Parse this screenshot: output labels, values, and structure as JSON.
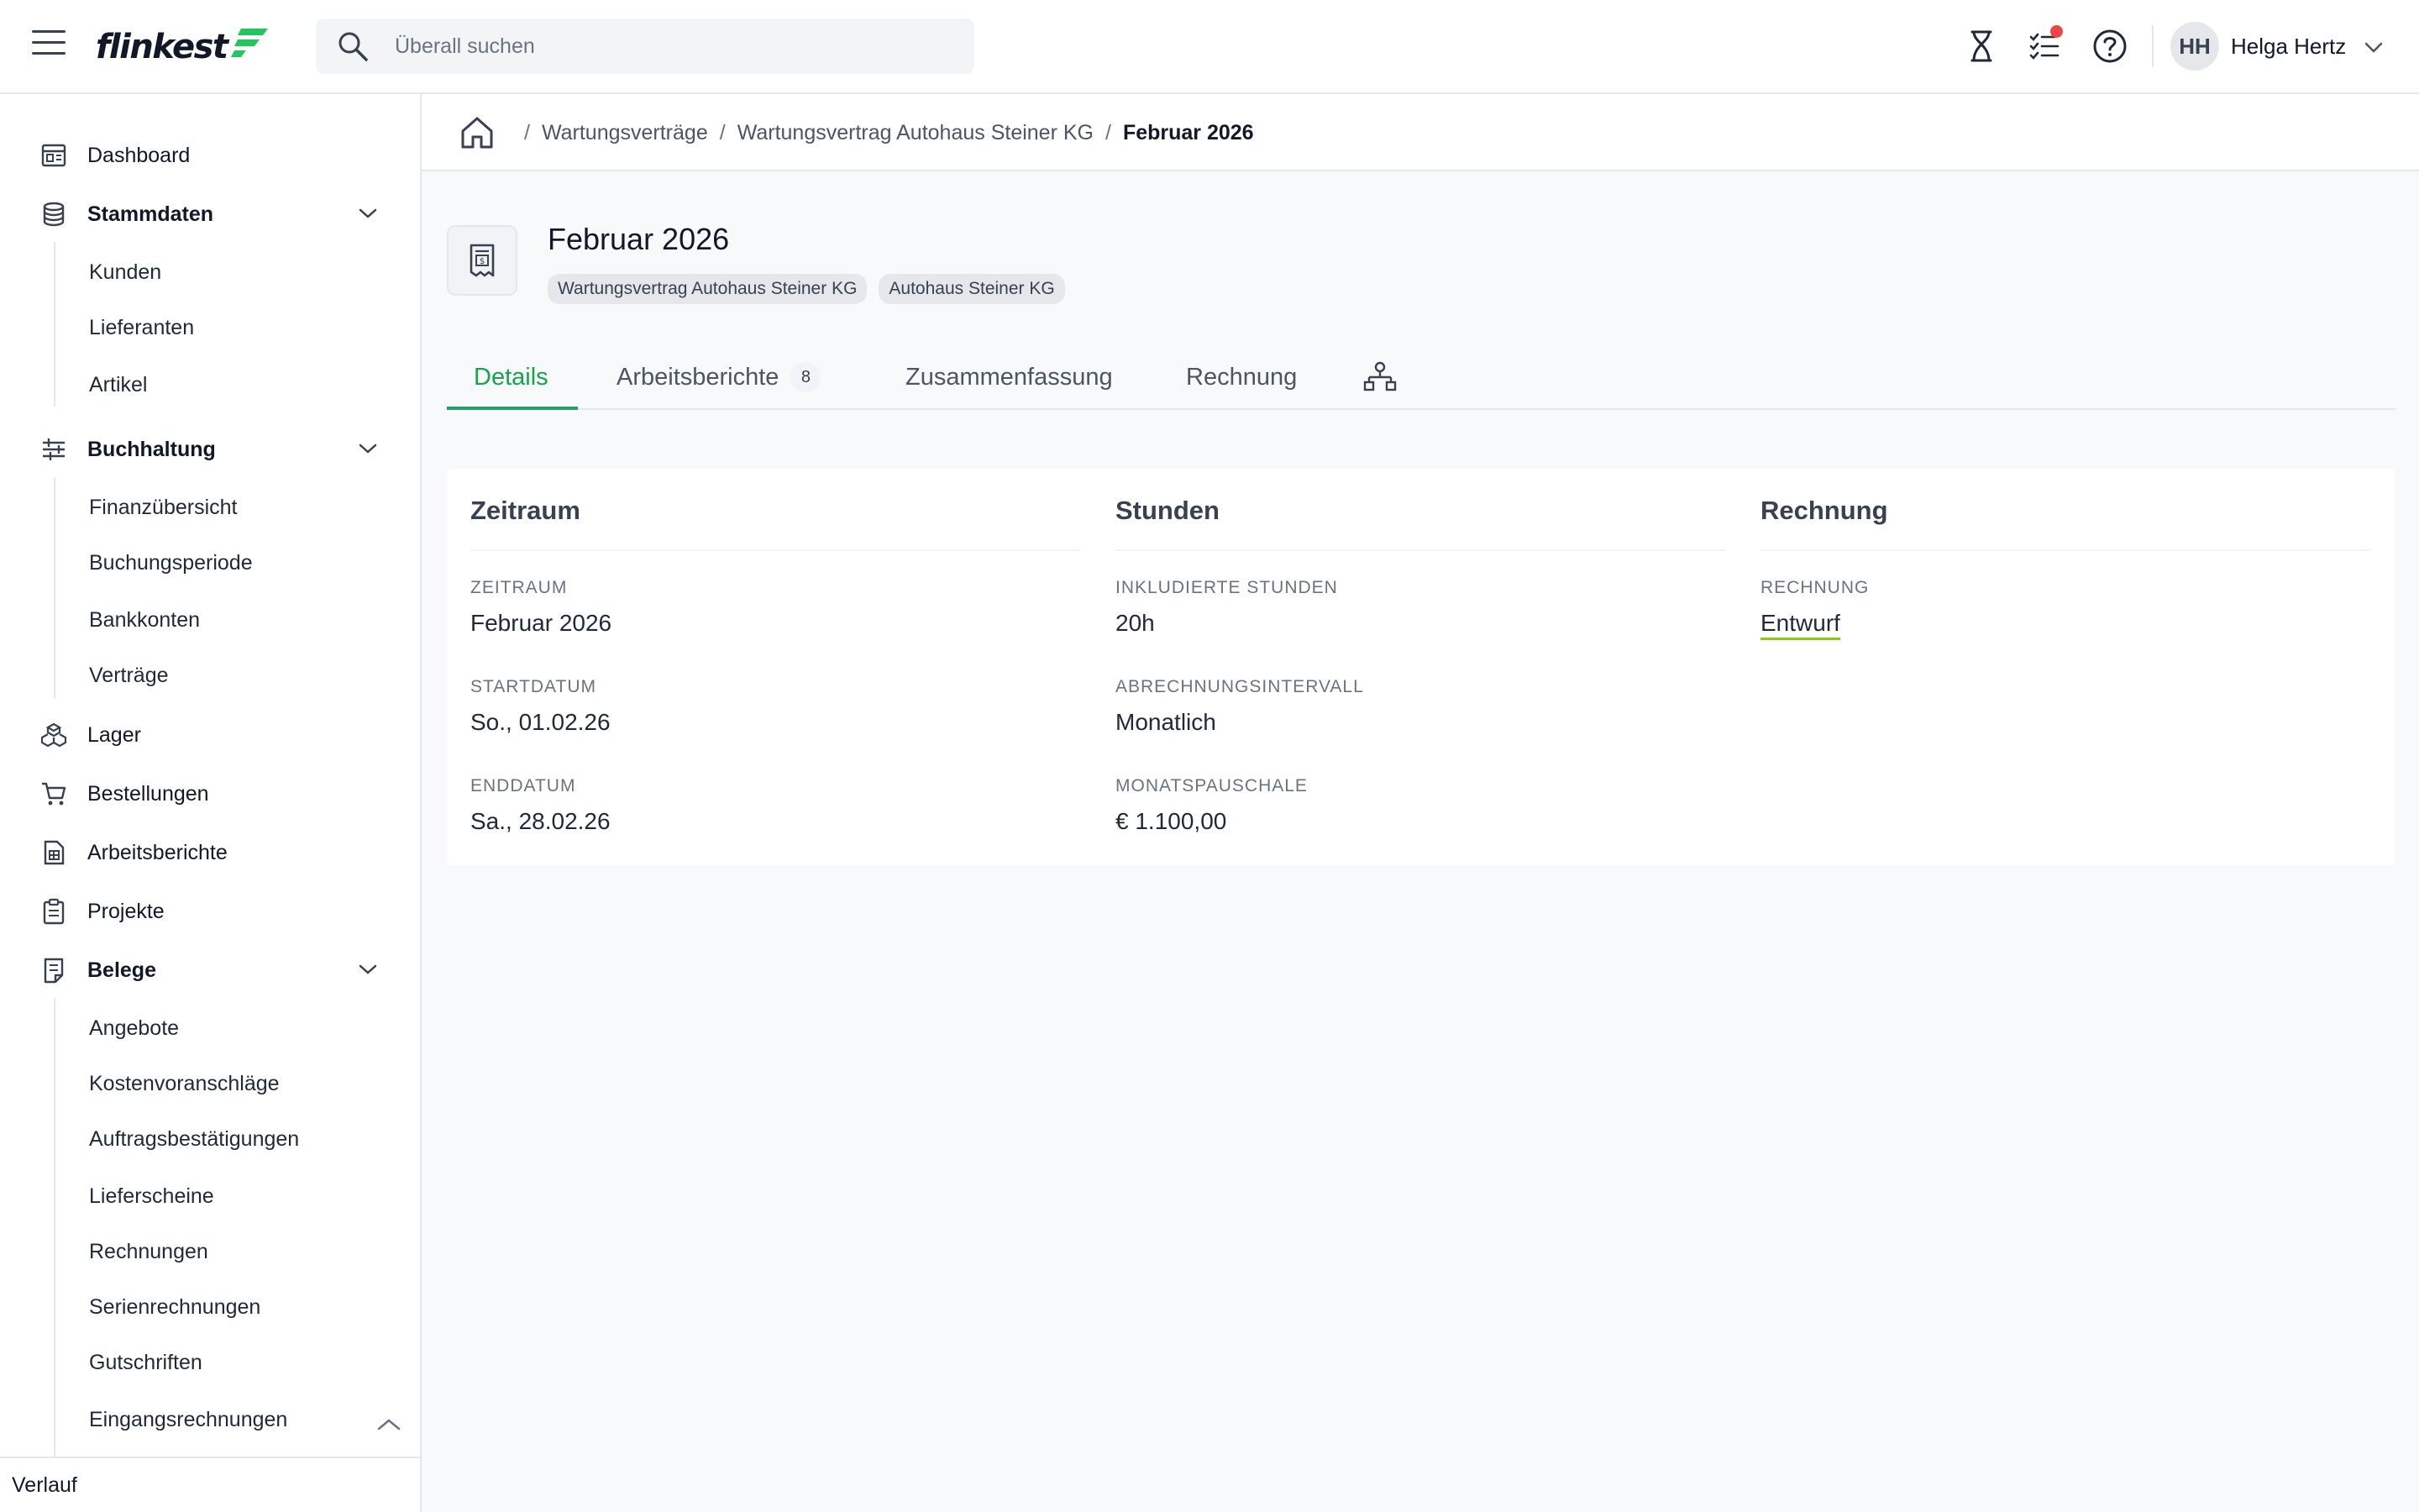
{
  "topbar": {
    "logo_text": "flinkest",
    "brand_color": "#22c55e",
    "search_placeholder": "Überall suchen",
    "icons": [
      "hamburger-icon",
      "search-icon",
      "hourglass-icon",
      "task-list-icon",
      "help-icon",
      "chevron-down-icon"
    ],
    "user": {
      "initials": "HH",
      "name": "Helga Hertz"
    }
  },
  "sidebar": {
    "items": [
      {
        "label": "Dashboard",
        "icon": "dashboard-icon"
      },
      {
        "label": "Stammdaten",
        "icon": "database-icon",
        "expanded": true,
        "children": [
          "Kunden",
          "Lieferanten",
          "Artikel"
        ]
      },
      {
        "label": "Buchhaltung",
        "icon": "sliders-icon",
        "expanded": true,
        "children": [
          "Finanzübersicht",
          "Buchungsperiode",
          "Bankkonten",
          "Verträge"
        ]
      },
      {
        "label": "Lager",
        "icon": "boxes-icon"
      },
      {
        "label": "Bestellungen",
        "icon": "cart-icon"
      },
      {
        "label": "Arbeitsberichte",
        "icon": "report-icon"
      },
      {
        "label": "Projekte",
        "icon": "clipboard-icon"
      },
      {
        "label": "Belege",
        "icon": "receipt-icon",
        "expanded": true,
        "children": [
          "Angebote",
          "Kostenvoranschläge",
          "Auftragsbestätigungen",
          "Lieferscheine",
          "Rechnungen",
          "Serienrechnungen",
          "Gutschriften",
          "Eingangsrechnungen"
        ]
      }
    ],
    "footer": "Verlauf"
  },
  "breadcrumb": {
    "items": [
      "Wartungsverträge",
      "Wartungsvertrag Autohaus Steiner KG"
    ],
    "current": "Februar 2026"
  },
  "header": {
    "title": "Februar 2026",
    "tags": [
      "Wartungsvertrag Autohaus Steiner KG",
      "Autohaus Steiner KG"
    ]
  },
  "tabs": [
    {
      "label": "Details",
      "active": true
    },
    {
      "label": "Arbeitsberichte",
      "count": "8"
    },
    {
      "label": "Zusammenfassung"
    },
    {
      "label": "Rechnung"
    },
    {
      "label": "",
      "icon": "hierarchy-icon"
    }
  ],
  "details": {
    "zeitraum": {
      "title": "Zeitraum",
      "fields": [
        {
          "label": "ZEITRAUM",
          "value": "Februar 2026"
        },
        {
          "label": "STARTDATUM",
          "value": "So., 01.02.26"
        },
        {
          "label": "ENDDATUM",
          "value": "Sa., 28.02.26"
        }
      ]
    },
    "stunden": {
      "title": "Stunden",
      "fields": [
        {
          "label": "INKLUDIERTE STUNDEN",
          "value": "20h"
        },
        {
          "label": "ABRECHNUNGSINTERVALL",
          "value": "Monatlich"
        },
        {
          "label": "MONATSPAUSCHALE",
          "value": "€ 1.100,00"
        }
      ]
    },
    "rechnung": {
      "title": "Rechnung",
      "fields": [
        {
          "label": "RECHNUNG",
          "value": "Entwurf"
        }
      ]
    }
  }
}
